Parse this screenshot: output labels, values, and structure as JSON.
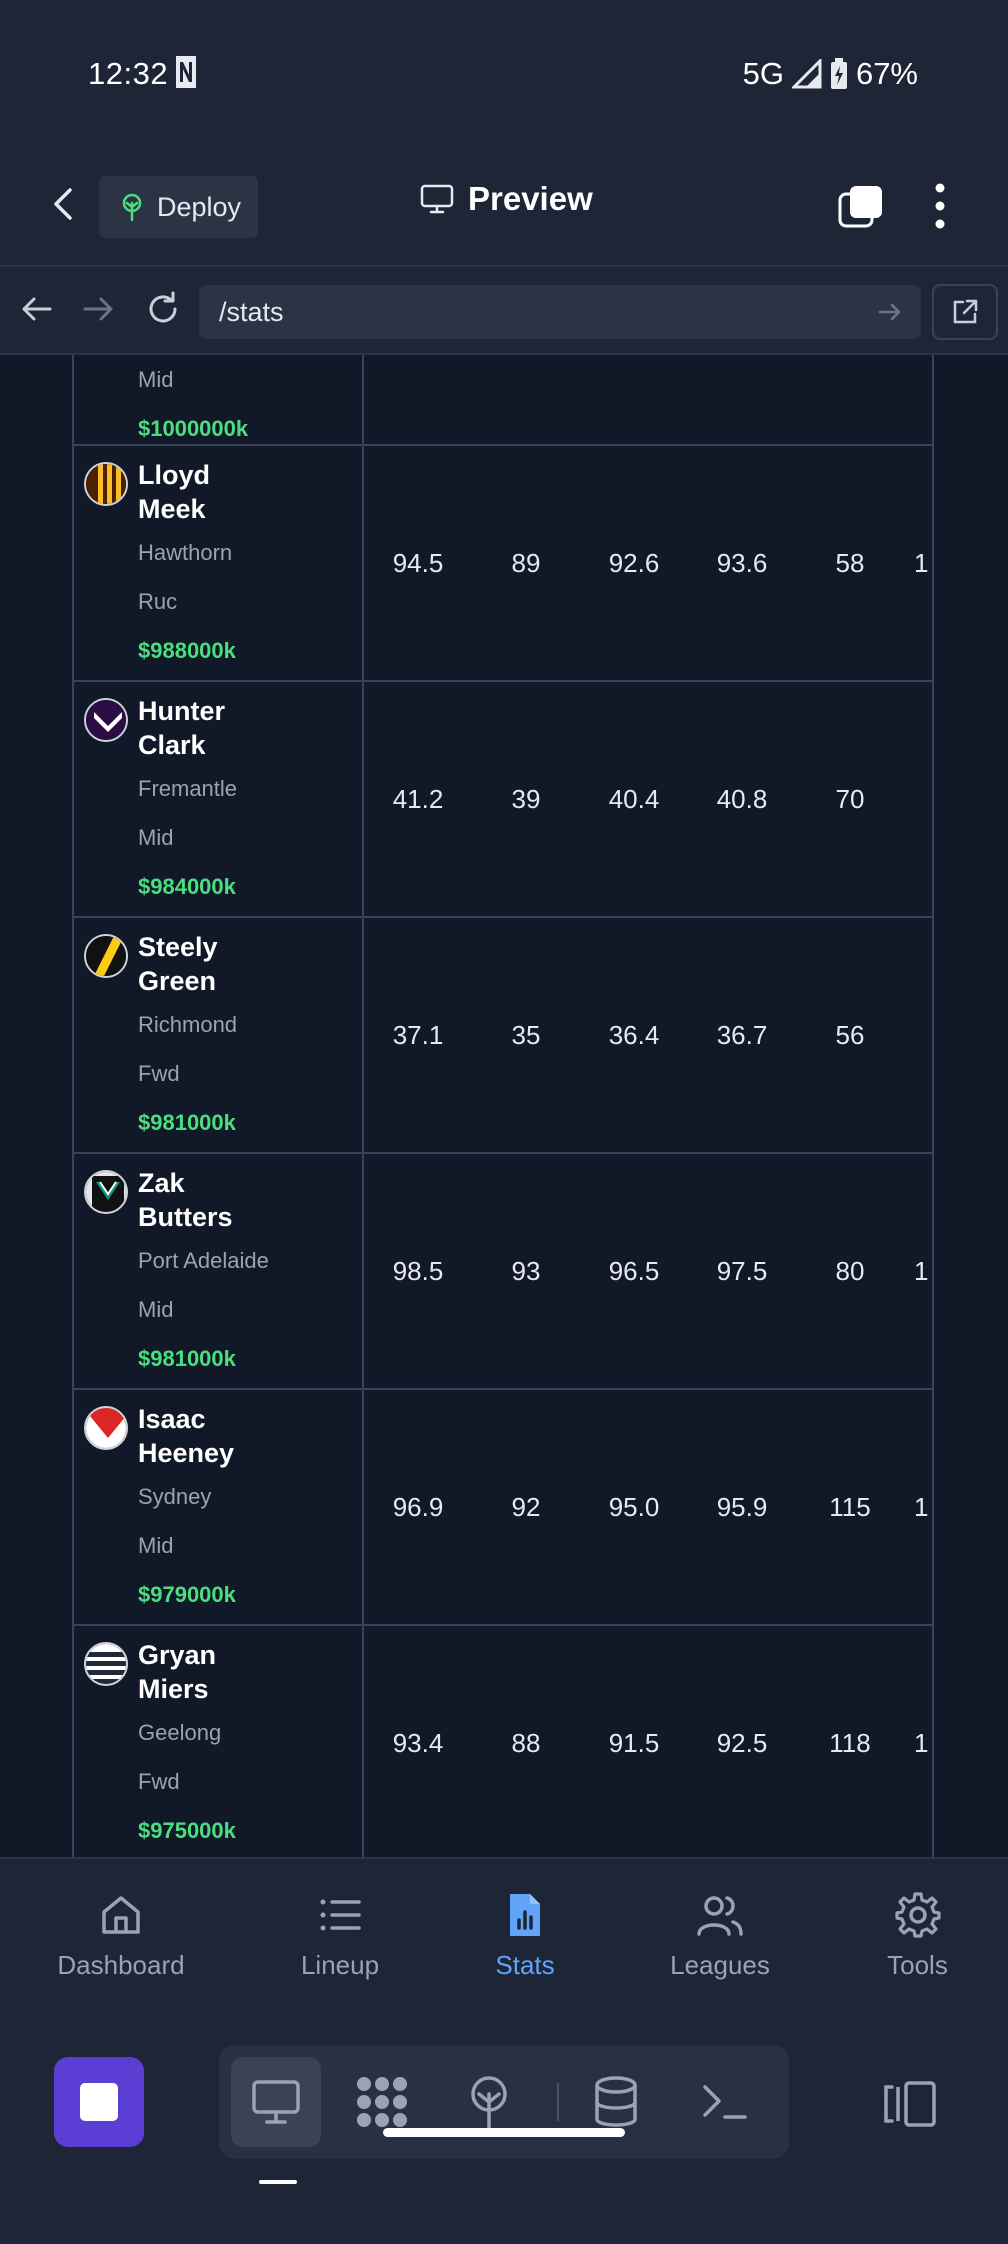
{
  "status": {
    "time": "12:32",
    "network": "5G",
    "battery": "67%"
  },
  "header": {
    "deploy_label": "Deploy",
    "title": "Preview"
  },
  "browser": {
    "url": "/stats"
  },
  "partial_row": {
    "position": "Mid",
    "price": "$1000000k"
  },
  "players": [
    {
      "first": "Lloyd",
      "last": "Meek",
      "team": "Hawthorn",
      "position": "Ruc",
      "price": "$988000k",
      "stats": [
        "94.5",
        "89",
        "92.6",
        "93.6",
        "58",
        "1"
      ],
      "guernsey": "hawthorn"
    },
    {
      "first": "Hunter",
      "last": "Clark",
      "team": "Fremantle",
      "position": "Mid",
      "price": "$984000k",
      "stats": [
        "41.2",
        "39",
        "40.4",
        "40.8",
        "70",
        ""
      ],
      "guernsey": "fremantle"
    },
    {
      "first": "Steely",
      "last": "Green",
      "team": "Richmond",
      "position": "Fwd",
      "price": "$981000k",
      "stats": [
        "37.1",
        "35",
        "36.4",
        "36.7",
        "56",
        ""
      ],
      "guernsey": "richmond"
    },
    {
      "first": "Zak",
      "last": "Butters",
      "team": "Port Adelaide",
      "position": "Mid",
      "price": "$981000k",
      "stats": [
        "98.5",
        "93",
        "96.5",
        "97.5",
        "80",
        "1"
      ],
      "guernsey": "port"
    },
    {
      "first": "Isaac",
      "last": "Heeney",
      "team": "Sydney",
      "position": "Mid",
      "price": "$979000k",
      "stats": [
        "96.9",
        "92",
        "95.0",
        "95.9",
        "115",
        "1"
      ],
      "guernsey": "sydney"
    },
    {
      "first": "Gryan",
      "last": "Miers",
      "team": "Geelong",
      "position": "Fwd",
      "price": "$975000k",
      "stats": [
        "93.4",
        "88",
        "91.5",
        "92.5",
        "118",
        "1"
      ],
      "guernsey": "geelong"
    }
  ],
  "bottom_nav": [
    {
      "label": "Dashboard",
      "icon": "home-icon",
      "active": false
    },
    {
      "label": "Lineup",
      "icon": "list-icon",
      "active": false
    },
    {
      "label": "Stats",
      "icon": "stats-file-icon",
      "active": true
    },
    {
      "label": "Leagues",
      "icon": "users-icon",
      "active": false
    },
    {
      "label": "Tools",
      "icon": "gear-icon",
      "active": false
    }
  ],
  "toolbar_icons": [
    "stop-icon",
    "monitor-icon",
    "puzzle-icon",
    "deploy-icon",
    "database-icon",
    "terminal-icon",
    "panel-icon"
  ],
  "colors": {
    "background": "#1e2536",
    "content_bg": "#111827",
    "price_green": "#4ade80",
    "active_blue": "#60a5fa",
    "stop_purple": "#5b3fd4"
  }
}
